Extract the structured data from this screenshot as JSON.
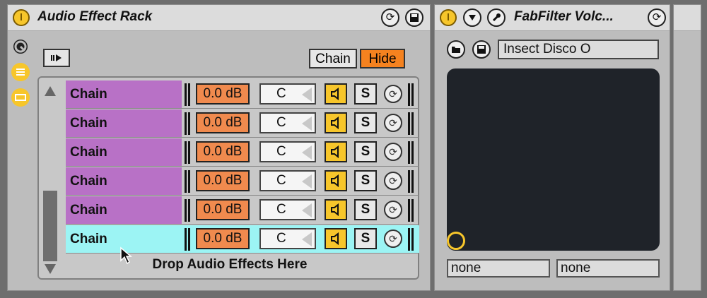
{
  "audio_rack": {
    "title": "Audio Effect Rack",
    "chain_button_label": "Chain",
    "hide_button_label": "Hide",
    "chains": [
      {
        "name": "Chain",
        "volume": "0.0 dB",
        "pan": "C",
        "solo": "S"
      },
      {
        "name": "Chain",
        "volume": "0.0 dB",
        "pan": "C",
        "solo": "S"
      },
      {
        "name": "Chain",
        "volume": "0.0 dB",
        "pan": "C",
        "solo": "S"
      },
      {
        "name": "Chain",
        "volume": "0.0 dB",
        "pan": "C",
        "solo": "S"
      },
      {
        "name": "Chain",
        "volume": "0.0 dB",
        "pan": "C",
        "solo": "S"
      },
      {
        "name": "Chain",
        "volume": "0.0 dB",
        "pan": "C",
        "solo": "S"
      }
    ],
    "drop_hint": "Drop Audio Effects Here"
  },
  "plugin": {
    "title": "FabFilter Volc...",
    "preset_name": "Insect Disco O",
    "param_x": "none",
    "param_y": "none"
  },
  "colors": {
    "chain_row": "#b871c6",
    "chain_selected": "#9cf4f4",
    "accent_yellow": "#f7c62b",
    "hide_orange": "#f5821f",
    "volume_orange": "#f08a4e",
    "xy_pad_bg": "#1f2329"
  },
  "icons": {
    "power": "power-icon",
    "hot_swap": "hot-swap-icon",
    "save": "save-icon",
    "dropdown": "triangle-down-icon",
    "wrench": "wrench-icon",
    "macro": "macro-knob-icon",
    "chain_list": "chain-list-icon",
    "device_list": "device-list-icon",
    "speaker": "speaker-icon",
    "folder": "folder-icon"
  }
}
